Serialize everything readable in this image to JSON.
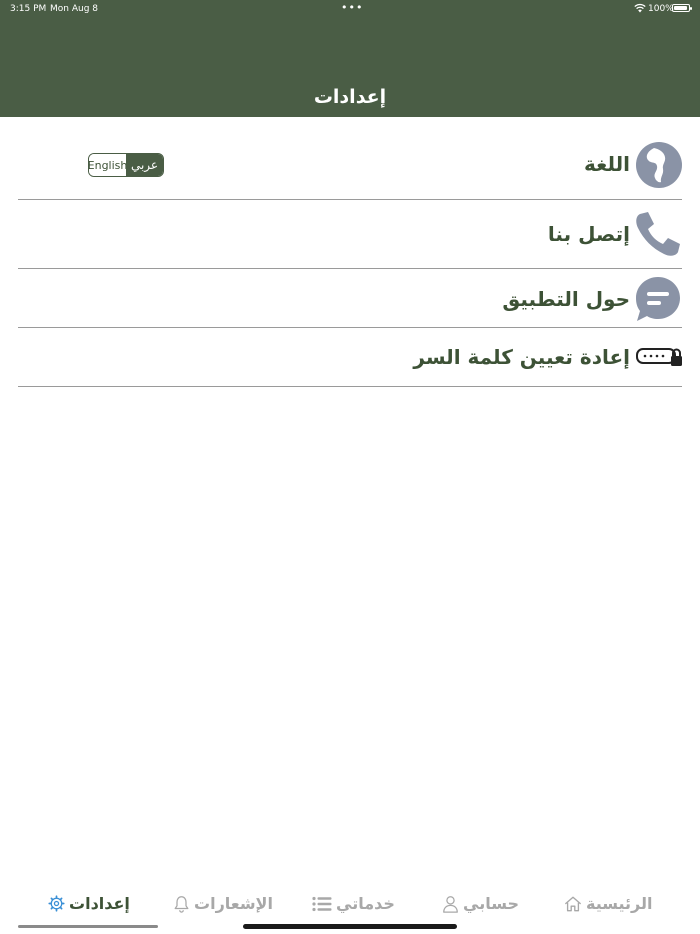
{
  "status_bar": {
    "time": "3:15 PM",
    "date": "Mon Aug 8",
    "dots": "•••",
    "battery": "100%"
  },
  "header": {
    "title": "إعدادات"
  },
  "settings": {
    "language": {
      "label": "اللغة",
      "icon": "globe-icon"
    },
    "lang_toggle": {
      "english": "English",
      "arabic": "عربي",
      "selected": "arabic"
    },
    "contact": {
      "label": "إتصل بنا",
      "icon": "phone-icon"
    },
    "about": {
      "label": "حول التطبيق",
      "icon": "chat-bubble-icon"
    },
    "reset_password": {
      "label": "إعادة تعيين كلمة السر",
      "icon": "password-lock-icon"
    }
  },
  "tabbar": {
    "settings": "إعدادات",
    "notifications": "الإشعارات",
    "services": "خدماتي",
    "account": "حسابي",
    "home": "الرئيسية",
    "active": "settings"
  },
  "colors": {
    "header_bg": "#4a5d45",
    "label_text": "#3d5236",
    "icon_gray": "#8a93a6",
    "tab_inactive": "#a8a8a8"
  }
}
